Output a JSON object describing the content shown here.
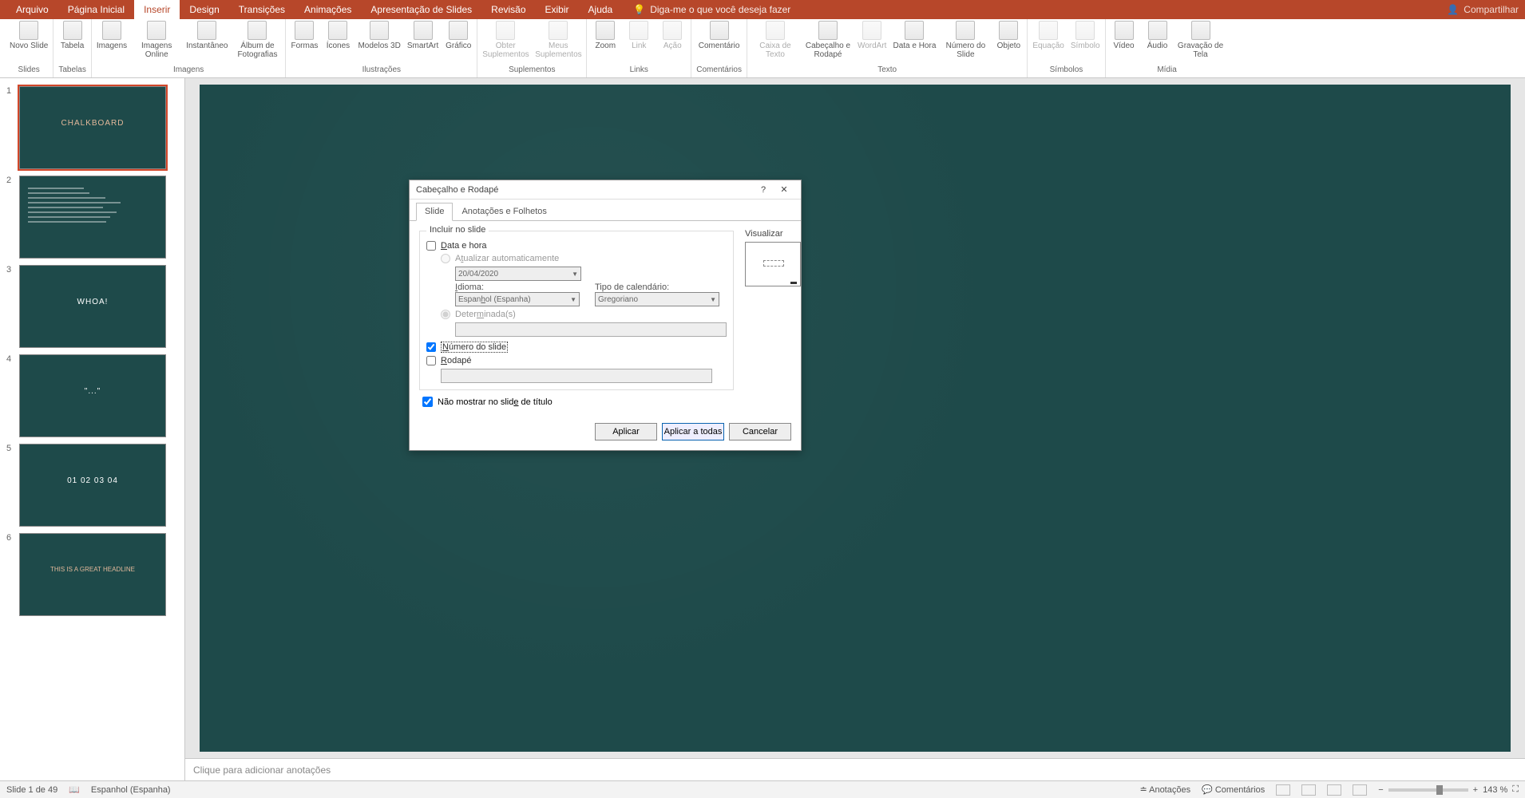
{
  "titlebar": {
    "tabs": [
      "Arquivo",
      "Página Inicial",
      "Inserir",
      "Design",
      "Transições",
      "Animações",
      "Apresentação de Slides",
      "Revisão",
      "Exibir",
      "Ajuda"
    ],
    "active_tab_index": 2,
    "tell_me": "Diga-me o que você deseja fazer",
    "share": "Compartilhar"
  },
  "ribbon": {
    "groups": [
      {
        "label": "Slides",
        "items": [
          {
            "label": "Novo\nSlide"
          }
        ]
      },
      {
        "label": "Tabelas",
        "items": [
          {
            "label": "Tabela"
          }
        ]
      },
      {
        "label": "Imagens",
        "items": [
          {
            "label": "Imagens"
          },
          {
            "label": "Imagens\nOnline"
          },
          {
            "label": "Instantâneo"
          },
          {
            "label": "Álbum de\nFotografias"
          }
        ]
      },
      {
        "label": "Ilustrações",
        "items": [
          {
            "label": "Formas"
          },
          {
            "label": "Ícones"
          },
          {
            "label": "Modelos\n3D"
          },
          {
            "label": "SmartArt"
          },
          {
            "label": "Gráfico"
          }
        ]
      },
      {
        "label": "Suplementos",
        "items": [
          {
            "label": "Obter Suplementos",
            "disabled": true
          },
          {
            "label": "Meus Suplementos",
            "disabled": true
          }
        ]
      },
      {
        "label": "Links",
        "items": [
          {
            "label": "Zoom"
          },
          {
            "label": "Link",
            "disabled": true
          },
          {
            "label": "Ação",
            "disabled": true
          }
        ]
      },
      {
        "label": "Comentários",
        "items": [
          {
            "label": "Comentário"
          }
        ]
      },
      {
        "label": "Texto",
        "items": [
          {
            "label": "Caixa\nde Texto",
            "disabled": true
          },
          {
            "label": "Cabeçalho\ne Rodapé"
          },
          {
            "label": "WordArt",
            "disabled": true
          },
          {
            "label": "Data e\nHora"
          },
          {
            "label": "Número\ndo Slide"
          },
          {
            "label": "Objeto"
          }
        ]
      },
      {
        "label": "Símbolos",
        "items": [
          {
            "label": "Equação",
            "disabled": true
          },
          {
            "label": "Símbolo",
            "disabled": true
          }
        ]
      },
      {
        "label": "Mídia",
        "items": [
          {
            "label": "Vídeo"
          },
          {
            "label": "Áudio"
          },
          {
            "label": "Gravação\nde Tela"
          }
        ]
      }
    ]
  },
  "slides": {
    "items": [
      {
        "num": "1",
        "title": "CHALKBOARD",
        "type": "title"
      },
      {
        "num": "2",
        "title": "",
        "type": "text"
      },
      {
        "num": "3",
        "title": "WHOA!",
        "type": "big"
      },
      {
        "num": "4",
        "title": "",
        "type": "quote"
      },
      {
        "num": "5",
        "title": "01 02 03 04",
        "type": "grid"
      },
      {
        "num": "6",
        "title": "THIS IS A GREAT HEADLINE",
        "type": "headline"
      }
    ],
    "selected": 0
  },
  "dialog": {
    "title": "Cabeçalho e Rodapé",
    "tabs": [
      "Slide",
      "Anotações e Folhetos"
    ],
    "active_tab": 0,
    "fieldset_label": "Incluir no slide",
    "date_time_label": "Data e hora",
    "date_time_checked": false,
    "auto_update_label": "Atualizar automaticamente",
    "date_value": "20/04/2020",
    "language_label": "Idioma:",
    "language_value": "Espanhol (Espanha)",
    "calendar_label": "Tipo de calendário:",
    "calendar_value": "Gregoriano",
    "fixed_label": "Determinada(s)",
    "slide_number_label": "Número do slide",
    "slide_number_checked": true,
    "footer_label": "Rodapé",
    "footer_checked": false,
    "no_title_label": "Não mostrar no slide de título",
    "no_title_checked": true,
    "preview_label": "Visualizar",
    "apply_label": "Aplicar",
    "apply_all_label": "Aplicar a todas",
    "cancel_label": "Cancelar"
  },
  "notes": {
    "placeholder": "Clique para adicionar anotações"
  },
  "statusbar": {
    "slide_info": "Slide 1 de 49",
    "language": "Espanhol (Espanha)",
    "notes_btn": "Anotações",
    "comments_btn": "Comentários",
    "zoom": "143 %"
  }
}
